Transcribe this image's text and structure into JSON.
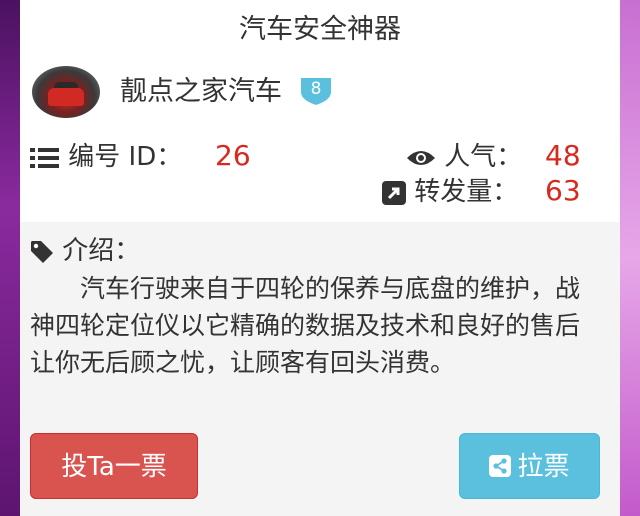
{
  "page": {
    "title": "汽车安全神器"
  },
  "shop": {
    "name": "靓点之家汽车",
    "level": "8"
  },
  "stats": {
    "id_label": "编号 ID：",
    "id_value": "26",
    "popularity_label": "人气：",
    "popularity_value": "48",
    "shares_label": "转发量：",
    "shares_value": "63"
  },
  "intro": {
    "label": "介绍：",
    "text": "汽车行驶来自于四轮的保养与底盘的维护，战神四轮定位仪以它精确的数据及技术和良好的售后让你无后顾之忧，让顾客有回头消费。"
  },
  "actions": {
    "vote_label": "投Ta一票",
    "canvass_label": "拉票"
  },
  "icons": {
    "list": "list-icon",
    "eye": "eye-icon",
    "share_square": "share-square-icon",
    "tag": "tag-icon",
    "share": "share-icon",
    "badge": "shield-badge-icon"
  },
  "colors": {
    "number_red": "#d9281d",
    "vote_button": "#d9534f",
    "canvass_button": "#5bc0de",
    "badge": "#5bc0de"
  }
}
